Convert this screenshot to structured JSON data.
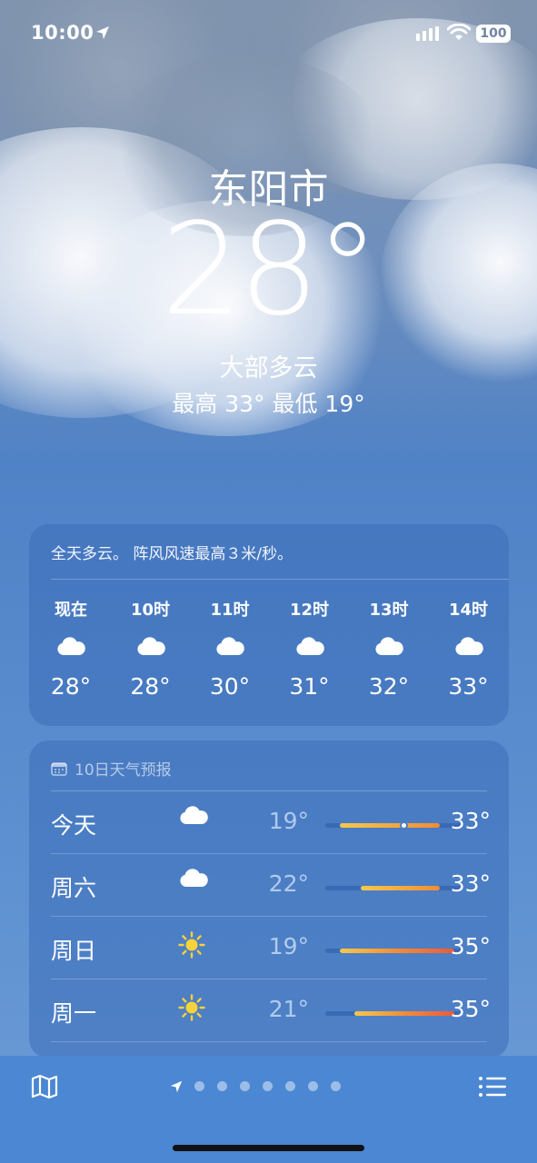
{
  "status_bar": {
    "time": "10:00",
    "battery": "100"
  },
  "current": {
    "city": "东阳市",
    "temperature": "28°",
    "condition": "大部多云",
    "high_low": "最高 33°  最低 19°"
  },
  "hourly": {
    "summary": "全天多云。 阵风风速最高３米/秒。",
    "items": [
      {
        "label": "现在",
        "icon": "cloud-icon",
        "temp": "28°"
      },
      {
        "label": "10时",
        "icon": "cloud-icon",
        "temp": "28°"
      },
      {
        "label": "11时",
        "icon": "cloud-icon",
        "temp": "30°"
      },
      {
        "label": "12时",
        "icon": "cloud-icon",
        "temp": "31°"
      },
      {
        "label": "13时",
        "icon": "cloud-icon",
        "temp": "32°"
      },
      {
        "label": "14时",
        "icon": "cloud-icon",
        "temp": "33°"
      }
    ]
  },
  "daily": {
    "header": "10日天气预报",
    "items": [
      {
        "day": "今天",
        "icon": "cloud-icon",
        "low": "19°",
        "high": "33°",
        "range": [
          19,
          33
        ],
        "current": 28
      },
      {
        "day": "周六",
        "icon": "cloud-icon",
        "low": "22°",
        "high": "33°",
        "range": [
          22,
          33
        ]
      },
      {
        "day": "周日",
        "icon": "sun-icon",
        "low": "19°",
        "high": "35°",
        "range": [
          19,
          35
        ]
      },
      {
        "day": "周一",
        "icon": "sun-icon",
        "low": "21°",
        "high": "35°",
        "range": [
          21,
          35
        ]
      }
    ],
    "scale": [
      17,
      36
    ]
  },
  "tab_bar": {
    "page_count": 7
  },
  "colors": {
    "cool": "#f2c94c",
    "warm": "#f28c38",
    "hot": "#eb5a3c"
  }
}
